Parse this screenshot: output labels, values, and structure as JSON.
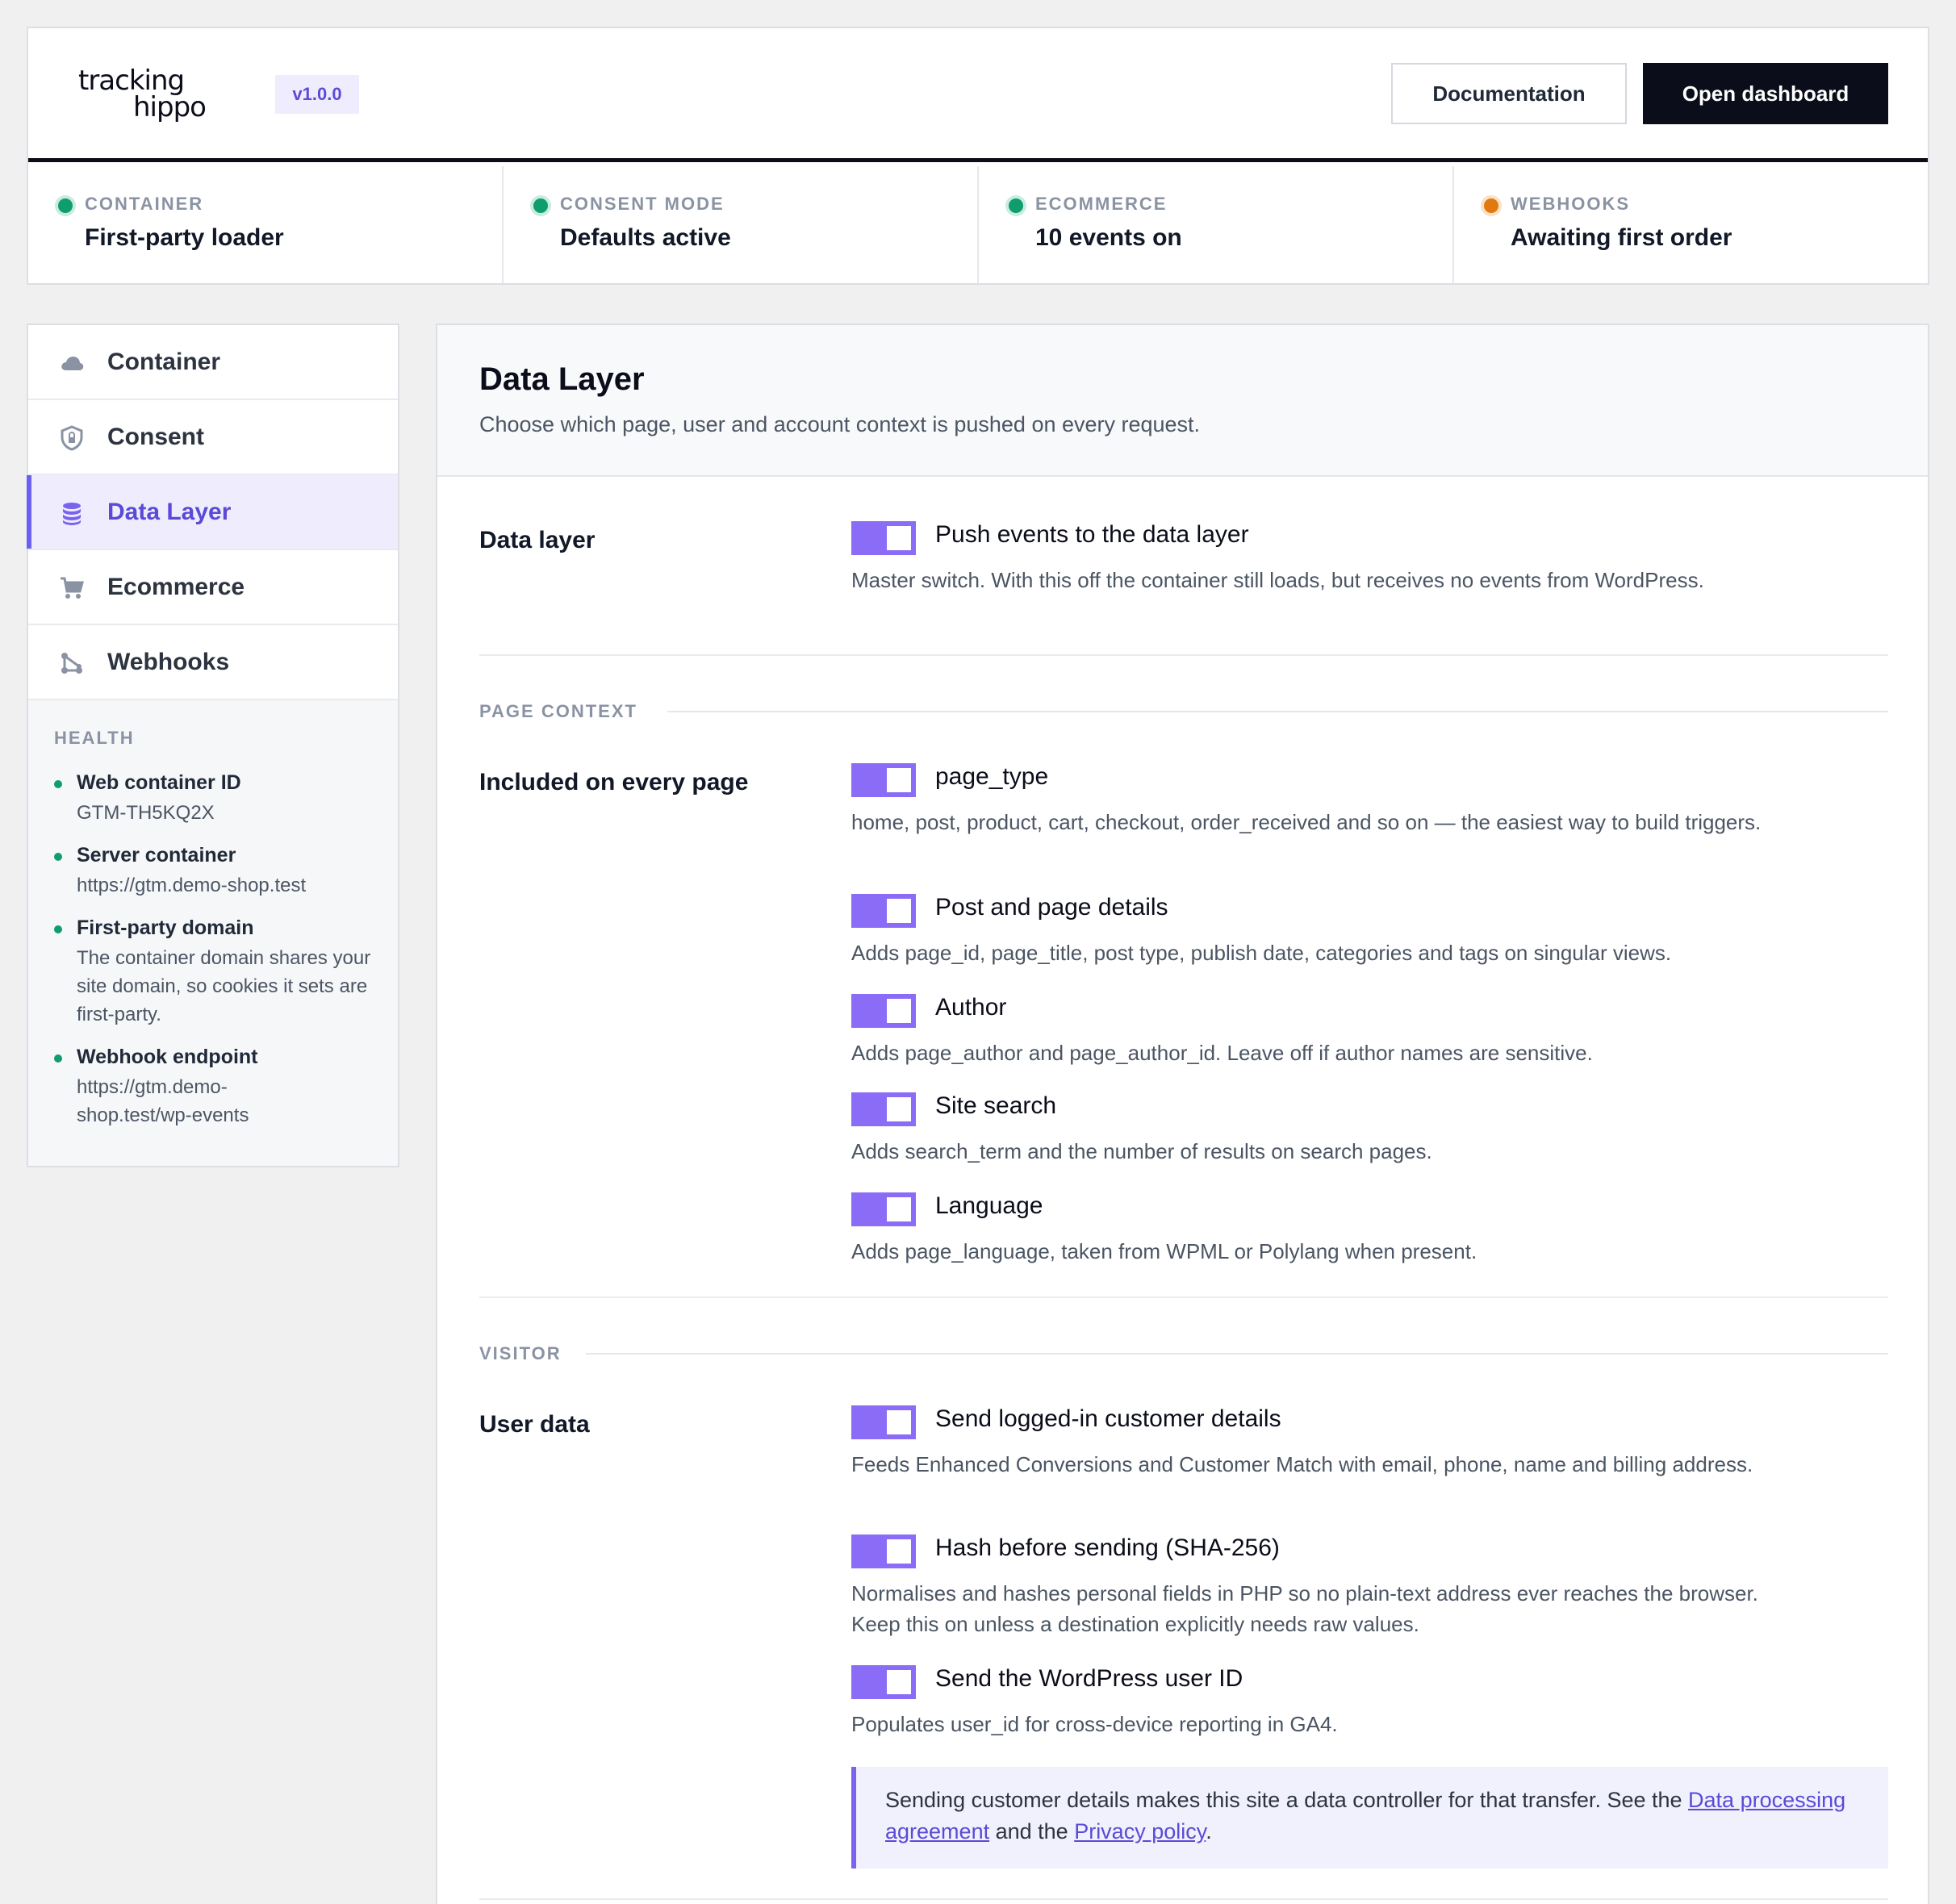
{
  "header": {
    "logo_line1": "tracking",
    "logo_line2": "hippo",
    "version": "v1.0.0",
    "documentation_label": "Documentation",
    "open_dashboard_label": "Open dashboard"
  },
  "status": [
    {
      "label": "CONTAINER",
      "value": "First-party loader",
      "color": "#0f9d6e"
    },
    {
      "label": "CONSENT MODE",
      "value": "Defaults active",
      "color": "#0f9d6e"
    },
    {
      "label": "ECOMMERCE",
      "value": "10 events on",
      "color": "#0f9d6e"
    },
    {
      "label": "WEBHOOKS",
      "value": "Awaiting first order",
      "color": "#e07a10"
    }
  ],
  "sidebar": {
    "items": [
      {
        "label": "Container",
        "icon": "cloud-icon"
      },
      {
        "label": "Consent",
        "icon": "shield-lock-icon"
      },
      {
        "label": "Data Layer",
        "icon": "database-icon",
        "active": true
      },
      {
        "label": "Ecommerce",
        "icon": "cart-icon"
      },
      {
        "label": "Webhooks",
        "icon": "webhook-icon"
      }
    ],
    "health": {
      "title": "HEALTH",
      "items": [
        {
          "label": "Web container ID",
          "value": "GTM-TH5KQ2X"
        },
        {
          "label": "Server container",
          "value": "https://gtm.demo-shop.test"
        },
        {
          "label": "First-party domain",
          "value": "The container domain shares your site domain, so cookies it sets are first-party."
        },
        {
          "label": "Webhook endpoint",
          "value": "https://gtm.demo-shop.test/wp-events"
        }
      ]
    }
  },
  "main": {
    "title": "Data Layer",
    "subtitle": "Choose which page, user and account context is pushed on every request.",
    "data_layer": {
      "label": "Data layer",
      "options": [
        {
          "title": "Push events to the data layer",
          "desc": "Master switch. With this off the container still loads, but receives no events from WordPress.",
          "enabled": true
        }
      ]
    },
    "page_context": {
      "section": "PAGE CONTEXT",
      "label": "Included on every page",
      "options": [
        {
          "title": "page_type",
          "desc": "home, post, product, cart, checkout, order_received and so on — the easiest way to build triggers.",
          "enabled": true
        },
        {
          "title": "Post and page details",
          "desc": "Adds page_id, page_title, post type, publish date, categories and tags on singular views.",
          "enabled": true
        },
        {
          "title": "Author",
          "desc": "Adds page_author and page_author_id. Leave off if author names are sensitive.",
          "enabled": true
        },
        {
          "title": "Site search",
          "desc": "Adds search_term and the number of results on search pages.",
          "enabled": true
        },
        {
          "title": "Language",
          "desc": "Adds page_language, taken from WPML or Polylang when present.",
          "enabled": true
        }
      ]
    },
    "visitor": {
      "section": "VISITOR",
      "label": "User data",
      "options": [
        {
          "title": "Send logged-in customer details",
          "desc": "Feeds Enhanced Conversions and Customer Match with email, phone, name and billing address.",
          "enabled": true
        },
        {
          "title": "Hash before sending (SHA-256)",
          "desc": "Normalises and hashes personal fields in PHP so no plain-text address ever reaches the browser. Keep this on unless a destination explicitly needs raw values.",
          "enabled": true
        },
        {
          "title": "Send the WordPress user ID",
          "desc": "Populates user_id for cross-device reporting in GA4.",
          "enabled": true
        }
      ],
      "notice": {
        "text_before": "Sending customer details makes this site a data controller for that transfer. See the ",
        "link1": "Data processing agreement",
        "text_middle": " and the ",
        "link2": "Privacy policy",
        "text_after": "."
      }
    }
  },
  "colors": {
    "accent": "#8b6cf6",
    "brand_dark": "#0b0d1a",
    "ok": "#0f9d6e",
    "warn": "#e07a10"
  }
}
